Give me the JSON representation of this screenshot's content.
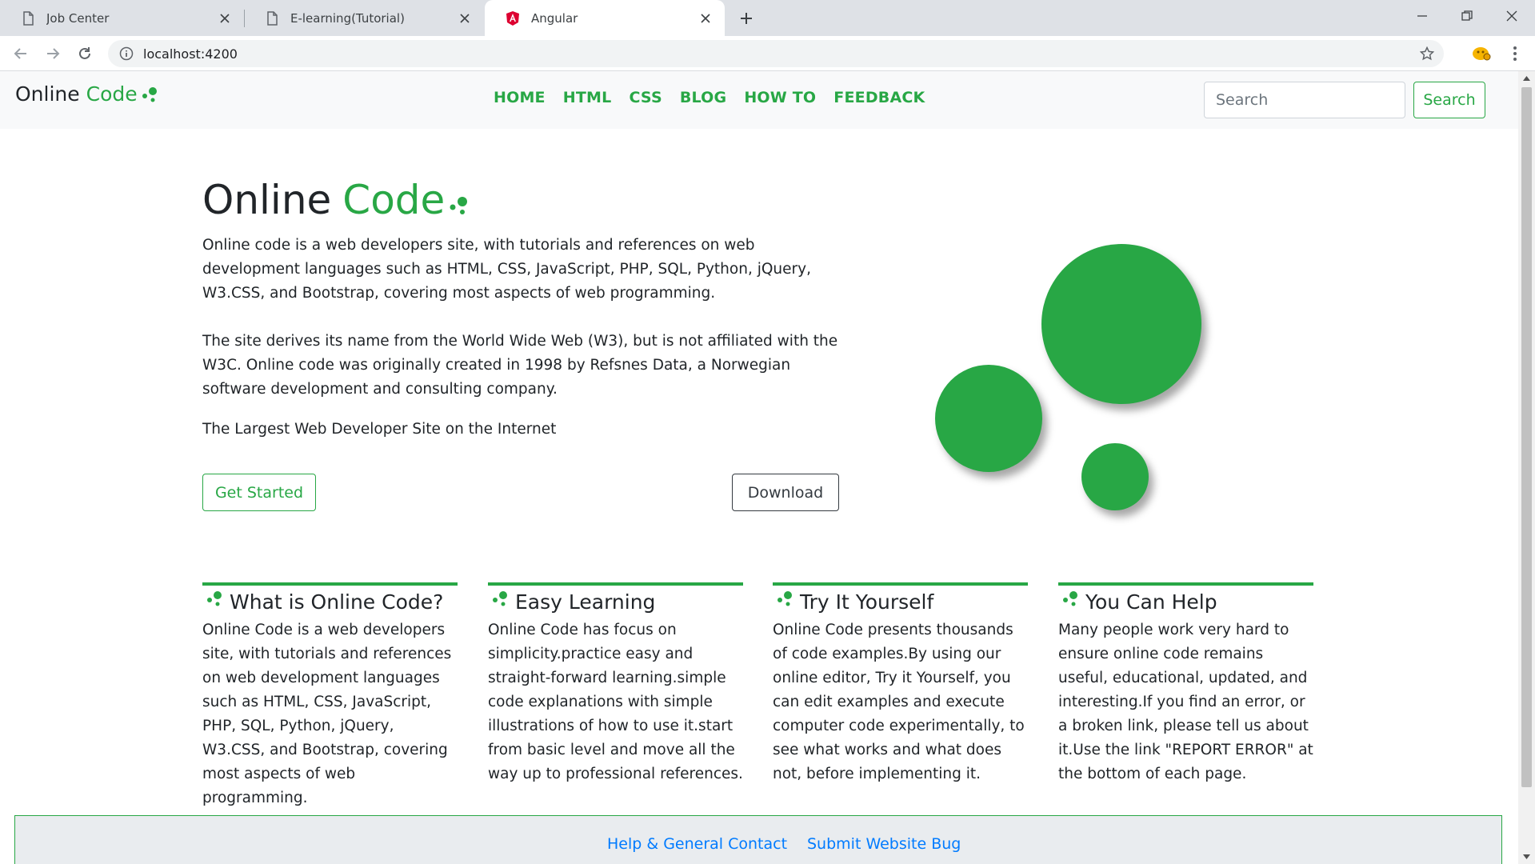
{
  "browser": {
    "tabs": [
      {
        "title": "Job Center",
        "icon": "page-icon"
      },
      {
        "title": "E-learning(Tutorial)",
        "icon": "page-icon"
      },
      {
        "title": "Angular",
        "icon": "angular-icon",
        "active": true
      }
    ],
    "url": "localhost:4200"
  },
  "site": {
    "brand": {
      "text_plain": "Online",
      "text_green": "Code"
    },
    "nav": [
      "HOME",
      "HTML",
      "CSS",
      "BLOG",
      "HOW TO",
      "FEEDBACK"
    ],
    "search": {
      "placeholder": "Search",
      "button": "Search"
    }
  },
  "hero": {
    "title_plain": "Online",
    "title_green": "Code",
    "p1": "Online code is a web developers site, with tutorials and references on web development languages such as HTML, CSS, JavaScript, PHP, SQL, Python, jQuery, W3.CSS, and Bootstrap, covering most aspects of web programming.",
    "p2": "The site derives its name from the World Wide Web (W3), but is not affiliated with the W3C. Online code was originally created in 1998 by Refsnes Data, a Norwegian software development and consulting company.",
    "p3": "The Largest Web Developer Site on the Internet",
    "btn_start": "Get Started",
    "btn_download": "Download"
  },
  "features": [
    {
      "title": "What is Online Code?",
      "text": "Online Code is a web developers site, with tutorials and references on web development languages such as HTML, CSS, JavaScript, PHP, SQL, Python, jQuery, W3.CSS, and Bootstrap, covering most aspects of web programming."
    },
    {
      "title": "Easy Learning",
      "text": "Online Code has focus on simplicity.practice easy and straight-forward learning.simple code explanations with simple illustrations of how to use it.start from basic level and move all the way up to professional references."
    },
    {
      "title": "Try It Yourself",
      "text": "Online Code presents thousands of code examples.By using our online editor, Try it Yourself, you can edit examples and execute computer code experimentally, to see what works and what does not, before implementing it."
    },
    {
      "title": "You Can Help",
      "text": "Many people work very hard to ensure online code remains useful, educational, updated, and interesting.If you find an error, or a broken link, please tell us about it.Use the link \"REPORT ERROR\" at the bottom of each page."
    }
  ],
  "footer": {
    "link1": "Help & General Contact",
    "link2": "Submit Website Bug"
  },
  "colors": {
    "brand_green": "#28a745",
    "link_blue": "#007bff",
    "navbar_bg": "#f8f9fa"
  }
}
